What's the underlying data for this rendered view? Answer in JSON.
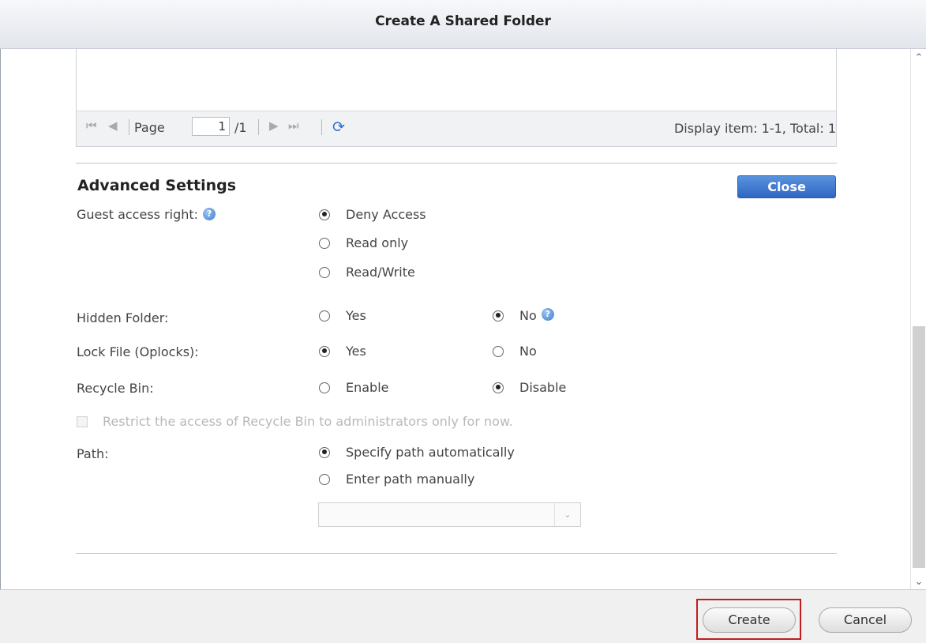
{
  "dialog": {
    "title": "Create A Shared Folder"
  },
  "pager": {
    "page_label": "Page",
    "page_value": "1",
    "page_total": "/1",
    "display_info": "Display item: 1-1, Total: 1"
  },
  "advanced": {
    "title": "Advanced Settings",
    "close_label": "Close",
    "guest": {
      "label": "Guest access right:",
      "options": [
        "Deny Access",
        "Read only",
        "Read/Write"
      ],
      "selected": "Deny Access"
    },
    "hidden": {
      "label": "Hidden Folder:",
      "yes": "Yes",
      "no": "No",
      "selected": "No"
    },
    "oplocks": {
      "label": "Lock File (Oplocks):",
      "yes": "Yes",
      "no": "No",
      "selected": "Yes"
    },
    "recycle": {
      "label": "Recycle Bin:",
      "enable": "Enable",
      "disable": "Disable",
      "selected": "Disable"
    },
    "restrict_recycle": {
      "label": "Restrict the access of Recycle Bin to administrators only for now.",
      "checked": false,
      "disabled": true
    },
    "path": {
      "label": "Path:",
      "auto": "Specify path automatically",
      "manual": "Enter path manually",
      "selected": "Specify path automatically",
      "dropdown_value": ""
    }
  },
  "footer": {
    "create_label": "Create",
    "cancel_label": "Cancel"
  },
  "colors": {
    "primary_button": "#2f66c2",
    "highlight": "#c21c1c",
    "help_icon": "#3f7fd0"
  }
}
